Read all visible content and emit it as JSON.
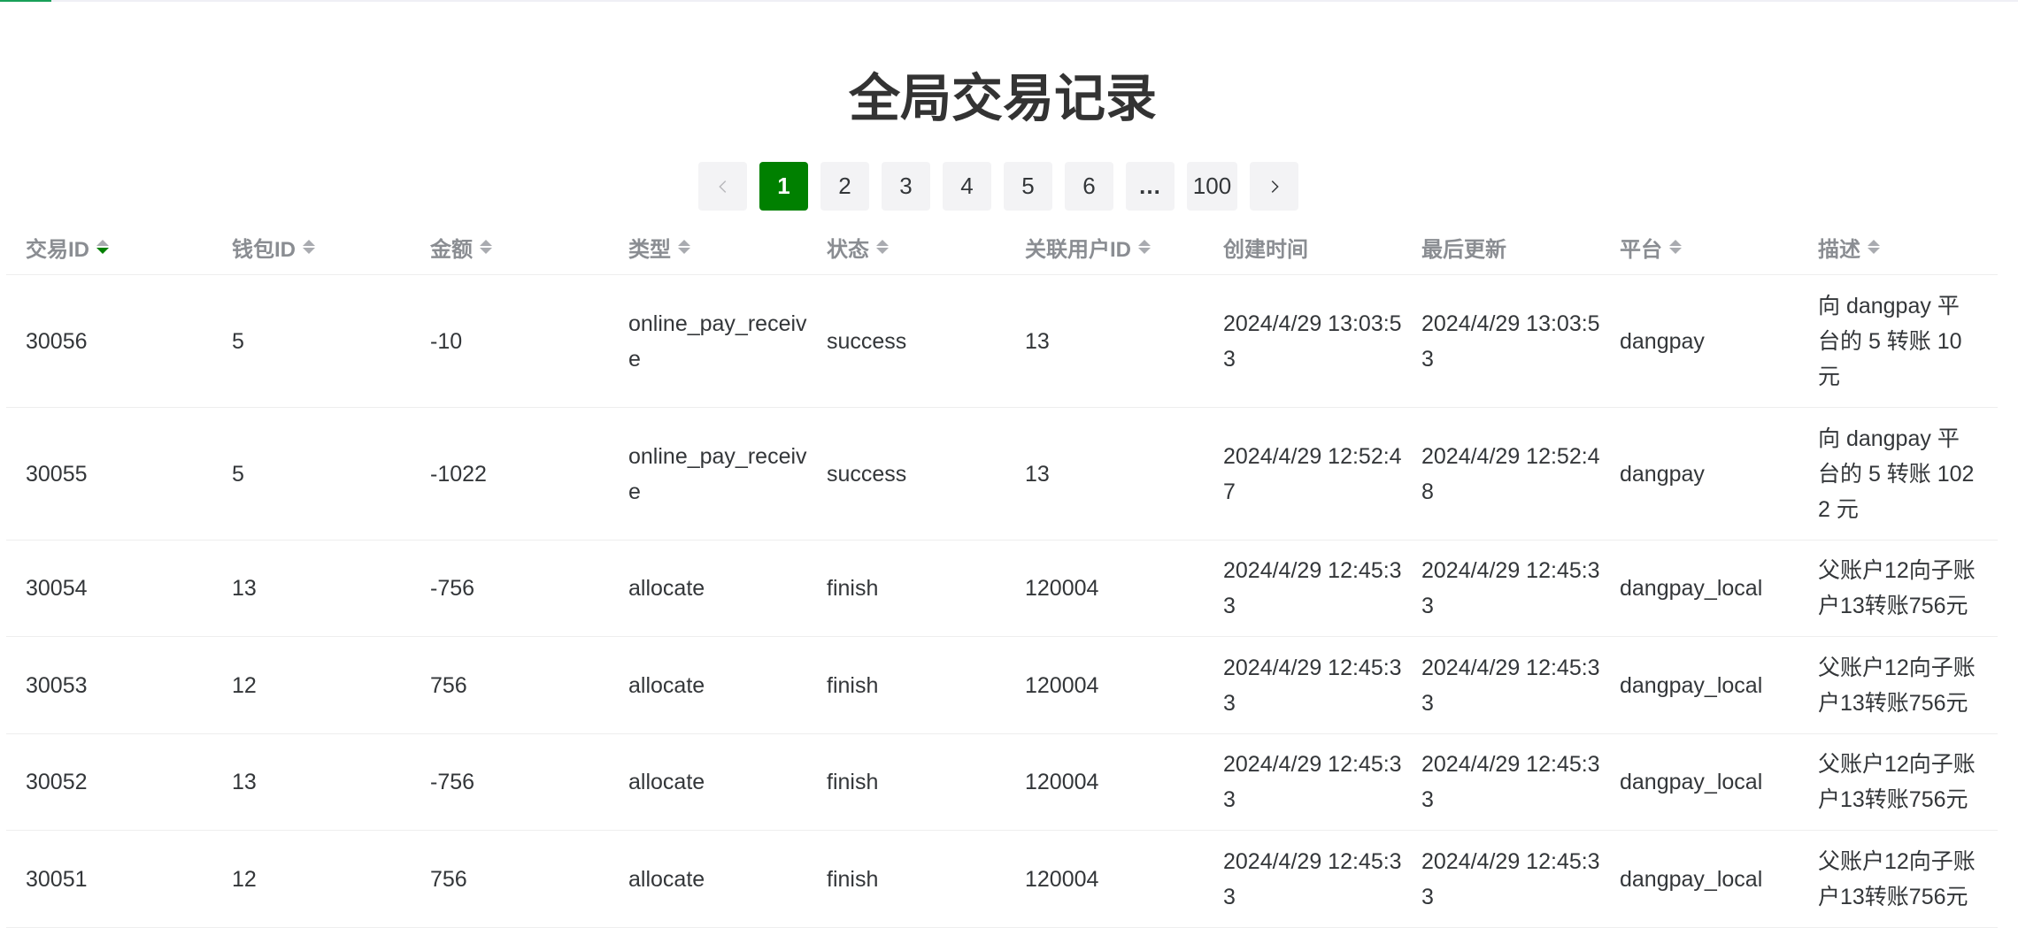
{
  "page": {
    "title": "全局交易记录"
  },
  "colors": {
    "accent": "#008000",
    "header_text": "#8a8d92"
  },
  "pagination": {
    "pages": [
      "1",
      "2",
      "3",
      "4",
      "5",
      "6",
      "…",
      "100"
    ],
    "current": "1"
  },
  "table": {
    "columns": [
      {
        "label": "交易ID",
        "sortable": true,
        "sorted": "desc"
      },
      {
        "label": "钱包ID",
        "sortable": true
      },
      {
        "label": "金额",
        "sortable": true
      },
      {
        "label": "类型",
        "sortable": true
      },
      {
        "label": "状态",
        "sortable": true
      },
      {
        "label": "关联用户ID",
        "sortable": true
      },
      {
        "label": "创建时间",
        "sortable": false
      },
      {
        "label": "最后更新",
        "sortable": false
      },
      {
        "label": "平台",
        "sortable": true
      },
      {
        "label": "描述",
        "sortable": true
      }
    ],
    "rows": [
      [
        "30056",
        "5",
        "-10",
        "online_pay_receive",
        "success",
        "13",
        "2024/4/29 13:03:53",
        "2024/4/29 13:03:53",
        "dangpay",
        "向 dangpay 平台的 5 转账 10 元"
      ],
      [
        "30055",
        "5",
        "-1022",
        "online_pay_receive",
        "success",
        "13",
        "2024/4/29 12:52:47",
        "2024/4/29 12:52:48",
        "dangpay",
        "向 dangpay 平台的 5 转账 1022 元"
      ],
      [
        "30054",
        "13",
        "-756",
        "allocate",
        "finish",
        "120004",
        "2024/4/29 12:45:33",
        "2024/4/29 12:45:33",
        "dangpay_local",
        "父账户12向子账户13转账756元"
      ],
      [
        "30053",
        "12",
        "756",
        "allocate",
        "finish",
        "120004",
        "2024/4/29 12:45:33",
        "2024/4/29 12:45:33",
        "dangpay_local",
        "父账户12向子账户13转账756元"
      ],
      [
        "30052",
        "13",
        "-756",
        "allocate",
        "finish",
        "120004",
        "2024/4/29 12:45:33",
        "2024/4/29 12:45:33",
        "dangpay_local",
        "父账户12向子账户13转账756元"
      ],
      [
        "30051",
        "12",
        "756",
        "allocate",
        "finish",
        "120004",
        "2024/4/29 12:45:33",
        "2024/4/29 12:45:33",
        "dangpay_local",
        "父账户12向子账户13转账756元"
      ]
    ]
  }
}
